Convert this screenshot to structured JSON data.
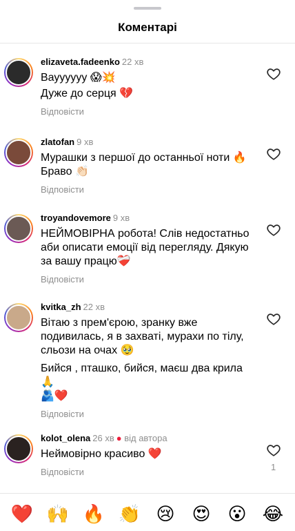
{
  "header": {
    "title": "Коментарі"
  },
  "comments": [
    {
      "username": "elizaveta.fadeenko",
      "time": "22 хв",
      "lines": [
        "Вауууууу 😱💥",
        "Дуже до серця 💔"
      ],
      "reply": "Відповісти",
      "avatar_color": "#2b2b2b"
    },
    {
      "username": "zlatofan",
      "time": "9 хв",
      "lines": [
        "Мурашки з першої до останньої ноти 🔥\nБраво 👏🏻"
      ],
      "reply": "Відповісти",
      "avatar_color": "#7a4a3a"
    },
    {
      "username": "troyandovemore",
      "time": "9 хв",
      "lines": [
        "НЕЙМОВІРНА робота! Слів недостатньо\nаби описати емоції від перегляду. Дякую\nза вашу працю❤️‍🩹"
      ],
      "reply": "Відповісти",
      "avatar_color": "#6b5a55"
    },
    {
      "username": "kvitka_zh",
      "time": "22 хв",
      "lines": [
        "Вітаю з прем'єрою, зранку вже\nподивилась, я в захваті, мурахи по тілу,\nсльози на очах 🥹",
        "Бийся , пташко, бийся, маєш два крила\n🙏\n🫂❤️"
      ],
      "reply": "Відповісти",
      "avatar_color": "#c9a98a"
    },
    {
      "username": "kolot_olena",
      "time": "26 хв",
      "author_badge": "від автора",
      "lines": [
        "Неймовірно красиво ❤️"
      ],
      "reply": "Відповісти",
      "like_count": "1",
      "avatar_color": "#2a2220"
    }
  ],
  "reactions": [
    "❤️",
    "🙌",
    "🔥",
    "👏",
    "😢",
    "😍",
    "😮",
    "😂"
  ],
  "colors": {
    "secondary_text": "#8e8e8e",
    "heart_red": "#ed1c3a"
  }
}
